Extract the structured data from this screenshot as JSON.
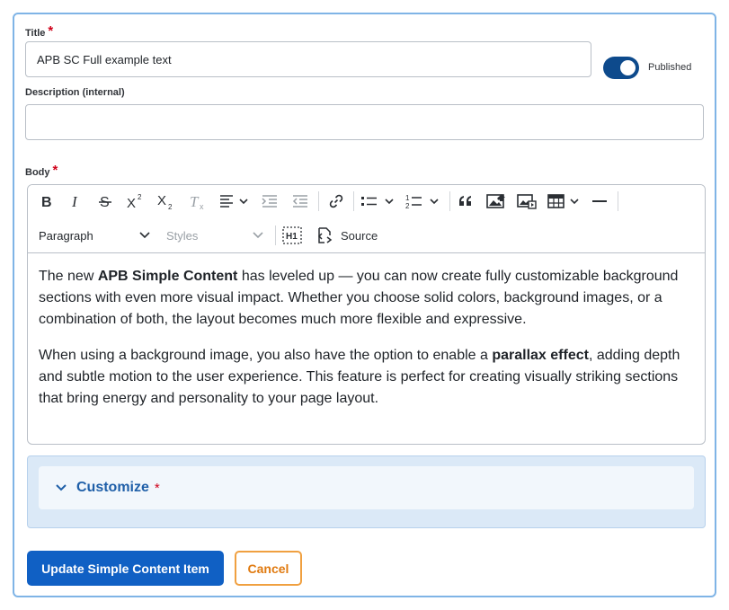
{
  "form": {
    "title_label": "Title",
    "title_required": "*",
    "title_value": "APB SC Full example text",
    "published_label": "Published",
    "published_on": true,
    "description_label": "Description (internal)",
    "description_value": "",
    "body_label": "Body",
    "body_required": "*"
  },
  "toolbar": {
    "heading_select": "Paragraph",
    "styles_select": "Styles",
    "source_label": "Source",
    "icons": [
      "bold-icon",
      "italic-icon",
      "strikethrough-icon",
      "superscript-icon",
      "subscript-icon",
      "remove-format-icon",
      "align-icon",
      "outdent-icon",
      "indent-icon",
      "link-icon",
      "bulleted-list-icon",
      "numbered-list-icon",
      "blockquote-icon",
      "insert-image-icon",
      "media-icon",
      "table-icon",
      "horizontal-line-icon",
      "heading-h1-icon",
      "source-icon"
    ]
  },
  "content": {
    "p1_a": "The new ",
    "p1_b": "APB Simple Content",
    "p1_c": " has leveled up — you can now create fully customizable background sections with even more visual impact. Whether you choose solid colors, background images, or a combination of both, the layout becomes much more flexible and expressive.",
    "p2_a": "When using a background image, you also have the option to enable a ",
    "p2_b": "parallax effect",
    "p2_c": ", adding depth and subtle motion to the user experience. This feature is perfect for creating visually striking sections that bring energy and personality to your page layout."
  },
  "customize": {
    "title": "Customize",
    "required": "*"
  },
  "actions": {
    "update_label": "Update Simple Content Item",
    "cancel_label": "Cancel"
  },
  "colors": {
    "primary": "#1060c4",
    "toggle": "#0d4a8c",
    "required": "#d0021b",
    "cancel": "#e07a10",
    "panel": "#dbe9f7"
  }
}
